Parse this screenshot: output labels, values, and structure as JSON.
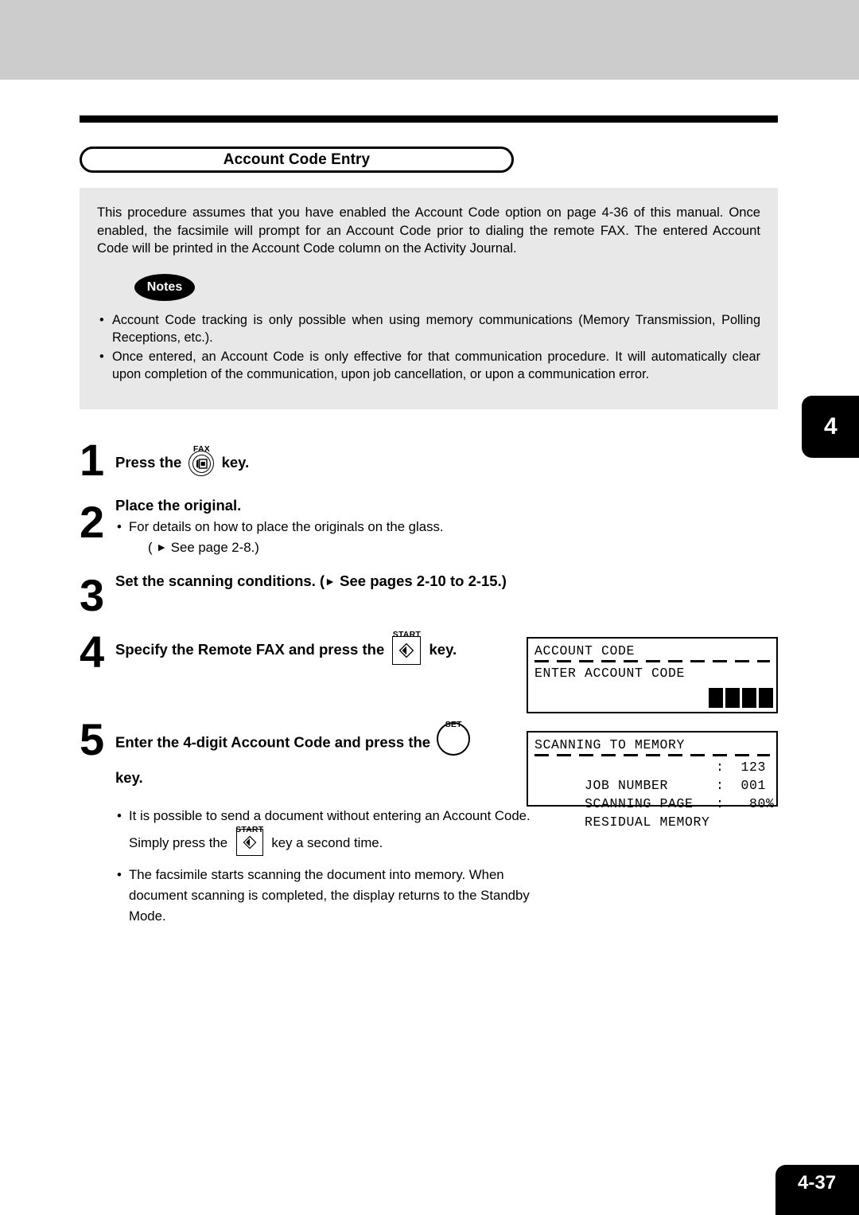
{
  "section": {
    "title": "Account Code Entry"
  },
  "intro": {
    "paragraph": "This procedure assumes that you have enabled the Account Code option on page 4-36 of this manual.  Once enabled, the facsimile will prompt for an Account Code prior to dialing the remote FAX.  The entered Account Code will be printed in the Account Code column on the Activity Journal."
  },
  "notes": {
    "badge_label": "Notes",
    "items": [
      "Account Code tracking is only possible when using memory communications (Memory Transmission, Polling Receptions, etc.).",
      "Once entered, an Account Code is only effective for that communication procedure. It will automatically clear upon completion of the communication, upon job cancellation, or upon a communication error."
    ]
  },
  "chapter_tab": {
    "number": "4"
  },
  "steps": [
    {
      "number": "1",
      "head_before": "Press the",
      "key": "fax-key",
      "key_label": "FAX",
      "head_after": "key."
    },
    {
      "number": "2",
      "head": "Place the original.",
      "bullet": "For details on how to place the originals on the glass.",
      "bullet_line2_prefix": "(",
      "bullet_line2_arrow": "►",
      "bullet_line2_text": "See page 2-8.)"
    },
    {
      "number": "3",
      "head_part1": "Set the scanning conditions.  (",
      "arrow": "►",
      "head_part2": "See pages 2-10 to 2-15.)"
    },
    {
      "number": "4",
      "head_before": "Specify the Remote FAX and press the",
      "key": "start-key",
      "key_label": "START",
      "head_after": "key."
    },
    {
      "number": "5",
      "head_before": "Enter the 4-digit Account Code and press the",
      "key": "set-key",
      "key_label": "SET",
      "head_after": "key.",
      "bullets": [
        {
          "text_before": "It is possible to send a document without entering an Account Code. Simply press the",
          "key": "start-key",
          "key_label": "START",
          "text_after": "key a second time."
        },
        {
          "text": "The facsimile starts scanning the document into memory. When document scanning is completed, the display returns to the Standby Mode."
        }
      ]
    }
  ],
  "lcd_panels": [
    {
      "id": "account-code",
      "title": "ACCOUNT CODE",
      "rows": [
        {
          "label": "ENTER ACCOUNT CODE",
          "value": ""
        }
      ],
      "cursor_blocks": 4
    },
    {
      "id": "scanning-to-memory",
      "title": "SCANNING TO MEMORY",
      "rows": [
        {
          "label": "JOB NUMBER",
          "value": ":  123"
        },
        {
          "label": "SCANNING PAGE",
          "value": ":  001"
        },
        {
          "label": "RESIDUAL MEMORY",
          "value": ":   80%"
        }
      ],
      "cursor_blocks": 0
    }
  ],
  "footer": {
    "page_number": "4-37"
  }
}
